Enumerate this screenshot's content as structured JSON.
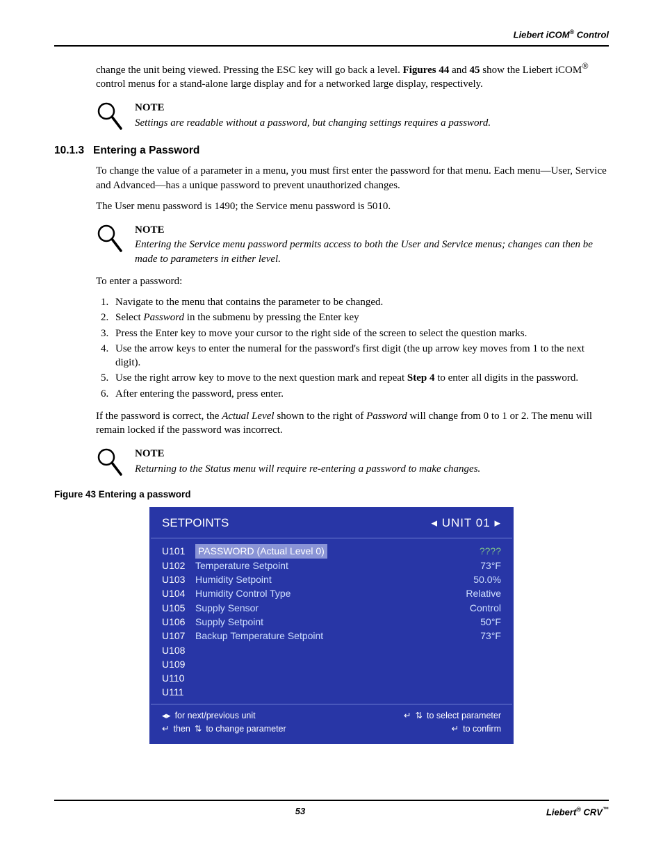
{
  "header": {
    "brand": "Liebert iCOM",
    "suffix": " Control"
  },
  "intro": {
    "p1_prefix": "change the unit being viewed. Pressing the ESC key will go back a level. ",
    "figs_a": "Figures 44",
    "and": " and ",
    "figs_b": "45",
    "p1_suffix": " show the Liebert iCOM",
    "reg": "®",
    "p1_tail": " control menus for a stand-alone large display and for a networked large display, respectively."
  },
  "note1": {
    "title": "NOTE",
    "body": "Settings are readable without a password, but changing settings requires a password."
  },
  "section": {
    "num": "10.1.3",
    "title": "Entering a Password",
    "p1": "To change the value of a parameter in a menu, you must first enter the password for that menu. Each menu—User, Service and Advanced—has a unique password to prevent unauthorized changes.",
    "p2": "The User menu password is 1490; the Service menu password is 5010."
  },
  "note2": {
    "title": "NOTE",
    "body": "Entering the Service menu password permits access to both the User and Service menus; changes can then be made to parameters in either level."
  },
  "pwd_intro": "To enter a password:",
  "steps": {
    "s1": "Navigate to the menu that contains the parameter to be changed.",
    "s2a": "Select ",
    "s2b": "Password",
    "s2c": " in the submenu by pressing the Enter key",
    "s3": "Press the Enter key to move your cursor to the right side of the screen to select the question marks.",
    "s4": "Use the arrow keys to enter the numeral for the password's first digit (the up arrow key moves from 1 to the next digit).",
    "s5a": "Use the right arrow key to move to the next question mark and repeat ",
    "s5b": "Step 4",
    "s5c": " to enter all digits in the password.",
    "s6": "After entering the password, press enter."
  },
  "para_after_a": "If the password is correct, the ",
  "para_after_b": "Actual Level",
  "para_after_c": " shown to the right of ",
  "para_after_d": "Password",
  "para_after_e": " will change from 0 to 1 or 2. The menu will remain locked if the password was incorrect.",
  "note3": {
    "title": "NOTE",
    "body": "Returning to the Status menu will require re-entering a password to make changes."
  },
  "figure_caption": "Figure 43  Entering a password",
  "screen": {
    "title_left": "SETPOINTS",
    "title_right": "UNIT  01",
    "rows": [
      {
        "code": "U101",
        "label": "PASSWORD   (Actual Level  0)",
        "value": "????",
        "selected": true
      },
      {
        "code": "U102",
        "label": "Temperature Setpoint",
        "value": "73°F"
      },
      {
        "code": "U103",
        "label": "Humidity Setpoint",
        "value": "50.0%"
      },
      {
        "code": "U104",
        "label": "Humidity Control Type",
        "value": "Relative"
      },
      {
        "code": "U105",
        "label": "Supply Sensor",
        "value": "Control"
      },
      {
        "code": "U106",
        "label": "Supply Setpoint",
        "value": "50°F"
      },
      {
        "code": "U107",
        "label": "Backup Temperature Setpoint",
        "value": "73°F"
      },
      {
        "code": "U108",
        "label": "",
        "value": ""
      },
      {
        "code": "U109",
        "label": "",
        "value": ""
      },
      {
        "code": "U110",
        "label": "",
        "value": ""
      },
      {
        "code": "U111",
        "label": "",
        "value": ""
      }
    ],
    "legend": {
      "l1": "for next/previous unit",
      "l2a": "then",
      "l2b": "to change parameter",
      "r1": "to select parameter",
      "r2": "to confirm"
    }
  },
  "footer": {
    "page": "53",
    "brand": "Liebert",
    "model": " CRV"
  }
}
